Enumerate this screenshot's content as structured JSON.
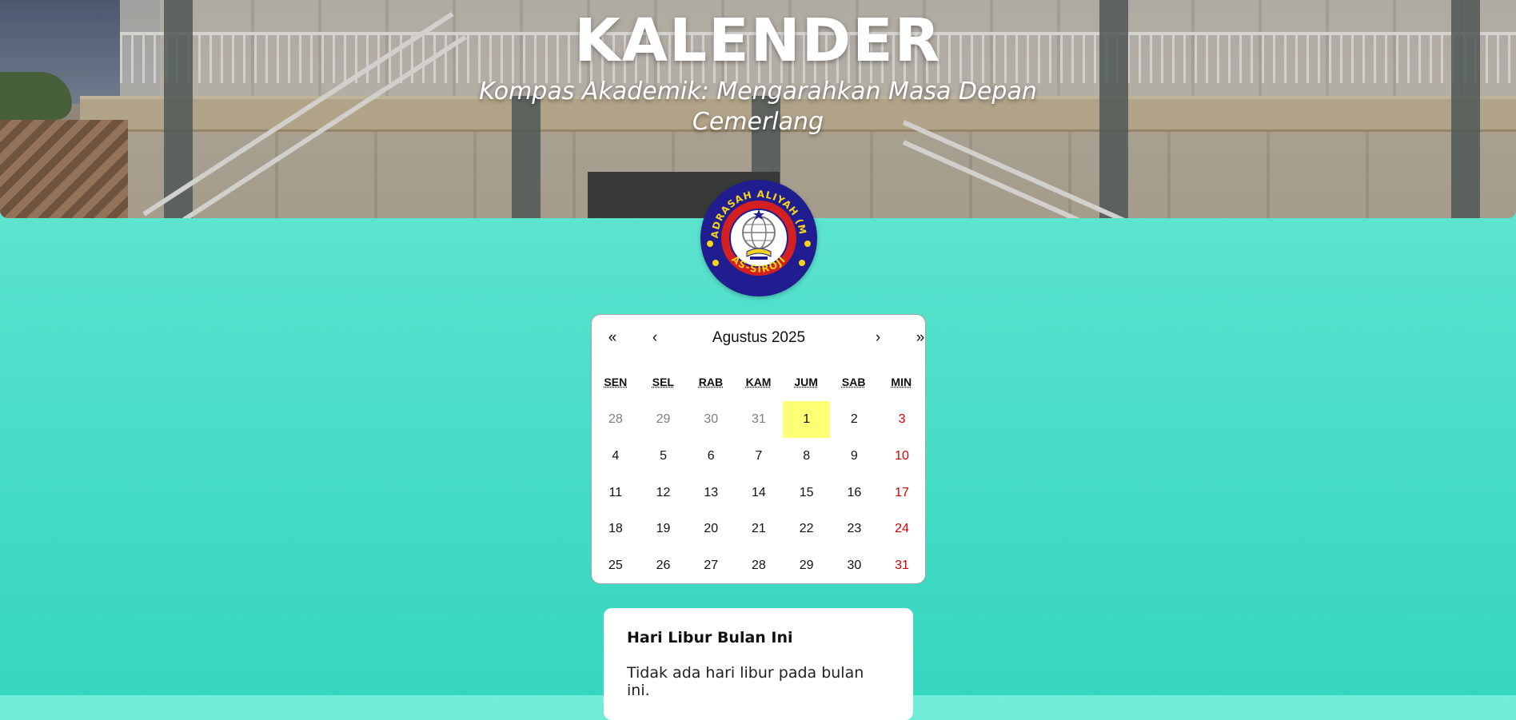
{
  "hero": {
    "title": "KALENDER",
    "subtitle": "Kompas Akademik: Mengarahkan Masa Depan Cemerlang"
  },
  "logo": {
    "top_text": "MADRASAH ALIYAH (MA)",
    "bottom_text": "AS-SIROJI",
    "colors": {
      "ring": "#1f1d8f",
      "inner": "#d42020",
      "text": "#f5d51a"
    }
  },
  "calendar": {
    "nav": {
      "prev2": "«",
      "prev": "‹",
      "next": "›",
      "next2": "»"
    },
    "month_label": "Agustus 2025",
    "weekdays": [
      "SEN",
      "SEL",
      "RAB",
      "KAM",
      "JUM",
      "SAB",
      "MIN"
    ],
    "weeks": [
      [
        "28",
        "29",
        "30",
        "31",
        "1",
        "2",
        "3"
      ],
      [
        "4",
        "5",
        "6",
        "7",
        "8",
        "9",
        "10"
      ],
      [
        "11",
        "12",
        "13",
        "14",
        "15",
        "16",
        "17"
      ],
      [
        "18",
        "19",
        "20",
        "21",
        "22",
        "23",
        "24"
      ],
      [
        "25",
        "26",
        "27",
        "28",
        "29",
        "30",
        "31"
      ]
    ],
    "neighbor_cells": [
      [
        0,
        0
      ],
      [
        0,
        1
      ],
      [
        0,
        2
      ],
      [
        0,
        3
      ]
    ],
    "today_cell": [
      0,
      4
    ],
    "colors": {
      "weekend": "#d10000",
      "neighbor": "#7d7d7d",
      "today_bg": "#ffff76"
    }
  },
  "holiday_card": {
    "title": "Hari Libur Bulan Ini",
    "message": "Tidak ada hari libur pada bulan ini."
  }
}
